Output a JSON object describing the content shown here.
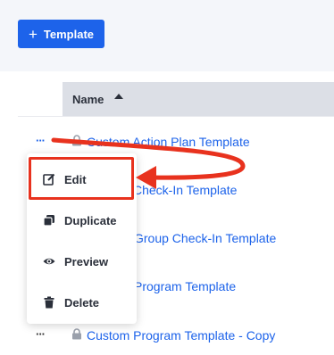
{
  "toolbar": {
    "add_template_label": "Template",
    "add_icon": "plus-icon"
  },
  "table": {
    "column_name": "Name",
    "rows": [
      {
        "name": "Custom Action Plan Template"
      },
      {
        "name": "Check-In Template"
      },
      {
        "name": "Group Check-In Template"
      },
      {
        "name": "Program Template"
      },
      {
        "name": "Custom Program Template - Copy"
      }
    ],
    "row_actions_label": "···"
  },
  "menu": {
    "items": [
      {
        "label": "Edit",
        "icon": "edit-icon"
      },
      {
        "label": "Duplicate",
        "icon": "duplicate-icon"
      },
      {
        "label": "Preview",
        "icon": "eye-icon"
      },
      {
        "label": "Delete",
        "icon": "trash-icon"
      }
    ]
  },
  "colors": {
    "primary": "#1d63ea",
    "annotation": "#e8321e",
    "header_bg": "#dcdfe6"
  }
}
